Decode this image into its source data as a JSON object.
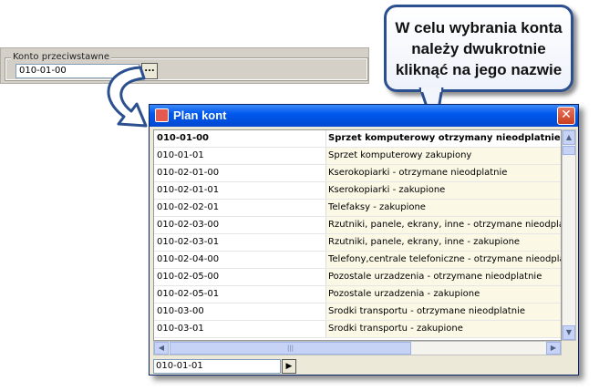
{
  "konto": {
    "legend": "Konto przeciwstawne",
    "value": "010-01-00",
    "browse_label": "..."
  },
  "callout": {
    "text": "W celu wybrania konta\nnależy dwukrotnie\nkliknąć na jego nazwie"
  },
  "window": {
    "title": "Plan kont",
    "close_label": "✕"
  },
  "rows": [
    {
      "code": "010-01-00",
      "name": "Sprzet komputerowy otrzymany nieodplatnie"
    },
    {
      "code": "010-01-01",
      "name": "Sprzet komputerowy zakupiony"
    },
    {
      "code": "010-02-01-00",
      "name": "Kserokopiarki - otrzymane nieodplatnie"
    },
    {
      "code": "010-02-01-01",
      "name": "Kserokopiarki - zakupione"
    },
    {
      "code": "010-02-02-01",
      "name": "Telefaksy - zakupione"
    },
    {
      "code": "010-02-03-00",
      "name": "Rzutniki, panele, ekrany, inne - otrzymane nieodplatni"
    },
    {
      "code": "010-02-03-01",
      "name": "Rzutniki, panele, ekrany, inne - zakupione"
    },
    {
      "code": "010-02-04-00",
      "name": "Telefony,centrale telefoniczne - otrzymane nieodplatni"
    },
    {
      "code": "010-02-05-00",
      "name": "Pozostale urzadzenia - otrzymane nieodplatnie"
    },
    {
      "code": "010-02-05-01",
      "name": "Pozostale urzadzenia - zakupione"
    },
    {
      "code": "010-03-00",
      "name": "Srodki transportu - otrzymane nieodplatnie"
    },
    {
      "code": "010-03-01",
      "name": "Srodki transportu  - zakupione"
    }
  ],
  "scroll": {
    "up": "▲",
    "down": "▼",
    "left": "◀",
    "right": "▶",
    "grip": "|||"
  },
  "search": {
    "value": "010-01-01",
    "go_label": "▶"
  },
  "colors": {
    "titlebar": "#0058ee",
    "callout_border": "#2b4f8f",
    "row_name_bg": "#fbf8e6"
  }
}
